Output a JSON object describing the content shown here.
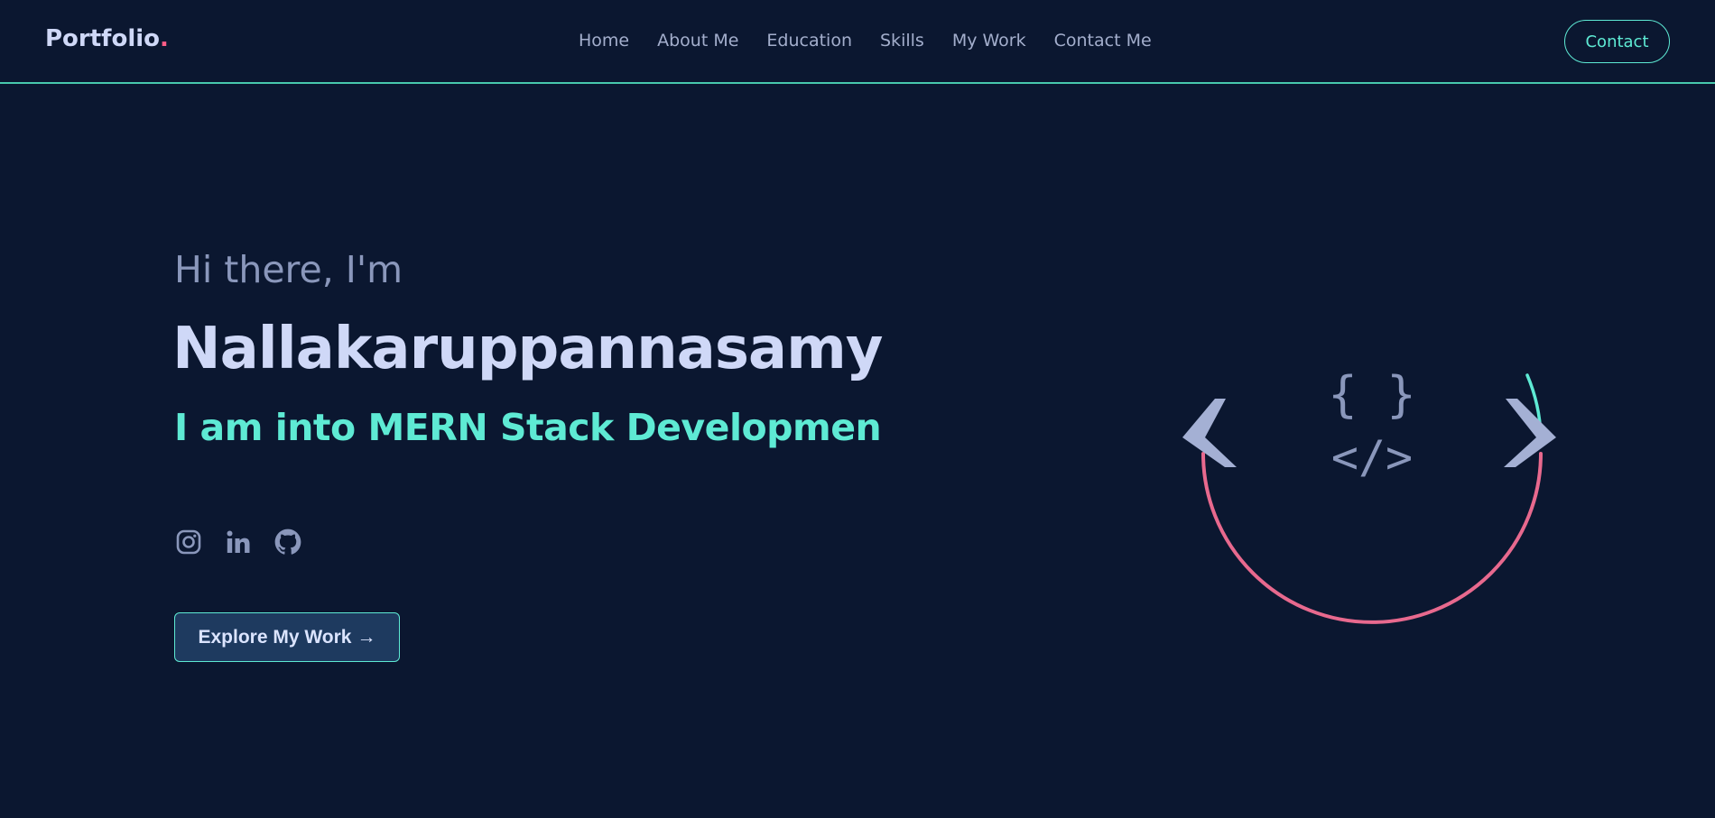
{
  "header": {
    "logo_text": "Portfolio",
    "logo_dot": ".",
    "nav": [
      "Home",
      "About Me",
      "Education",
      "Skills",
      "My Work",
      "Contact Me"
    ],
    "contact_label": "Contact"
  },
  "hero": {
    "greeting": "Hi there, I'm",
    "name": "Nallakaruppannasamy",
    "role": "I am into MERN Stack Developmen",
    "socials": [
      "instagram-icon",
      "linkedin-icon",
      "github-icon"
    ],
    "explore_label": "Explore My Work",
    "explore_arrow": "→"
  },
  "colors": {
    "background": "#0b1730",
    "accent": "#5eead4",
    "pink": "#ff5d87",
    "text_light": "#cfd8f7",
    "text_muted": "#8a97bb"
  }
}
